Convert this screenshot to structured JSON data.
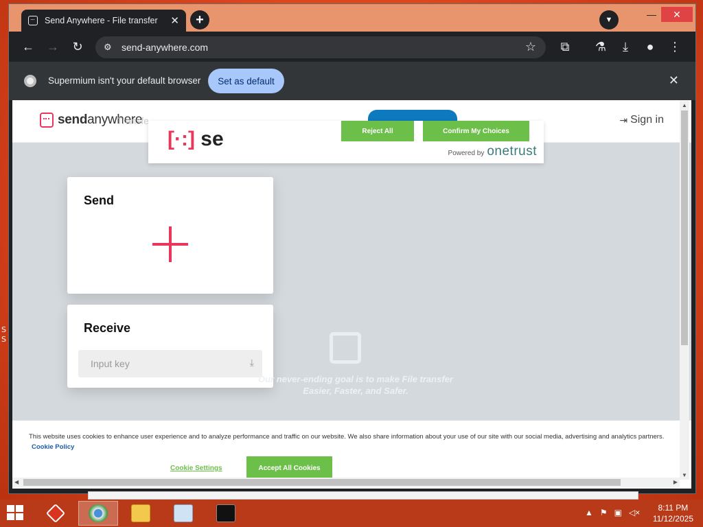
{
  "browser": {
    "tab_title": "Send Anywhere - File transfer",
    "tab_close": "✕",
    "new_tab": "+",
    "url": "send-anywhere.com",
    "window_controls": {
      "minimize": "—",
      "maximize": "☐",
      "close": "✕"
    }
  },
  "infobar": {
    "message": "Supermium isn't your default browser",
    "button": "Set as default",
    "close": "✕"
  },
  "site": {
    "logo_send": "send",
    "logo_anywhere": "anywhere",
    "ghost_nav": "Transfe",
    "signin": "Sign in",
    "send_card": {
      "title": "Send"
    },
    "receive_card": {
      "title": "Receive",
      "input_placeholder": "Input key"
    },
    "slogan": "Our never-ending goal is to make File transfer Easier, Faster, and Safer."
  },
  "onetrust": {
    "logo_text": "se",
    "reject": "Reject All",
    "confirm": "Confirm My Choices",
    "powered_by": "Powered by",
    "brand": "onetrust"
  },
  "cookie_banner": {
    "text": "This website uses cookies to enhance user experience and to analyze performance and traffic on our website. We also share information about your use of our site with our social media, advertising and analytics partners.",
    "policy_link": "Cookie Policy",
    "settings": "Cookie Settings",
    "accept": "Accept All Cookies"
  },
  "taskbar": {
    "time": "8:11 PM",
    "date": "11/12/2025"
  },
  "colors": {
    "brand_red": "#e8375a",
    "accept_green": "#6cc04a",
    "set_default_blue": "#a8c7fa"
  }
}
